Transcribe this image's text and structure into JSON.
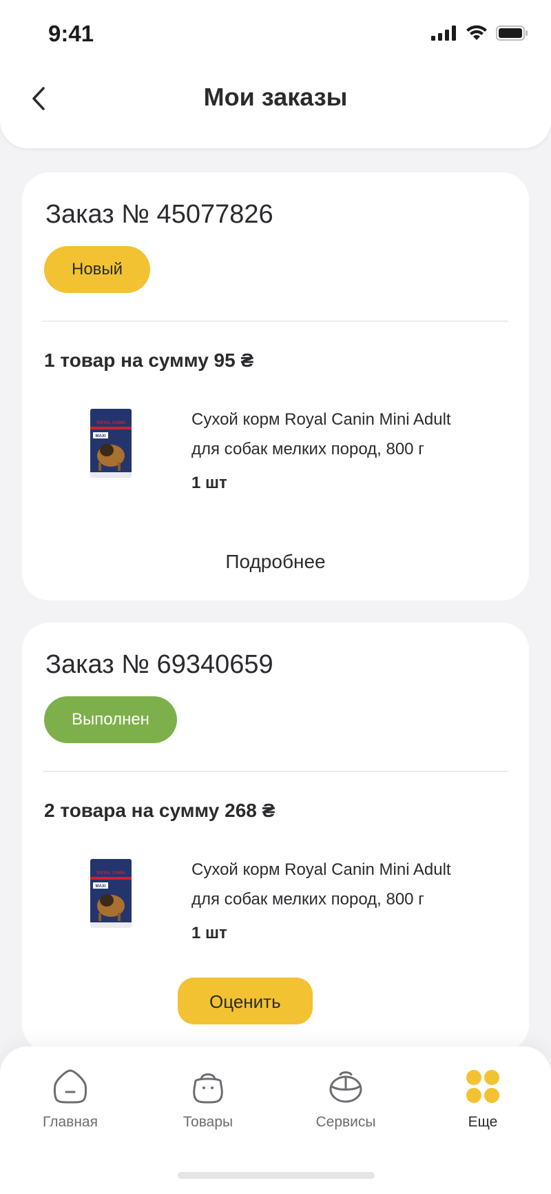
{
  "status_bar": {
    "time": "9:41"
  },
  "header": {
    "title": "Мои заказы"
  },
  "orders": [
    {
      "title": "Заказ № 45077826",
      "status": "Новый",
      "summary": "1 товар на сумму 95 ₴",
      "products": [
        {
          "name": "Сухой корм Royal Canin Mini Adult для собак мелких пород, 800 г",
          "quantity": "1 шт",
          "image_brand": "ROYAL CANIN",
          "image_variant": "MAXI"
        }
      ],
      "details_label": "Подробнее"
    },
    {
      "title": "Заказ № 69340659",
      "status": "Выполнен",
      "summary": "2 товара на сумму 268 ₴",
      "products": [
        {
          "name": "Сухой корм Royal Canin Mini Adult для собак мелких пород, 800 г",
          "quantity": "1 шт",
          "image_brand": "ROYAL CANIN",
          "image_variant": "MAXI"
        }
      ],
      "rate_label": "Оценить"
    }
  ],
  "tabbar": {
    "items": [
      {
        "label": "Главная",
        "icon": "home-icon"
      },
      {
        "label": "Товары",
        "icon": "bag-icon"
      },
      {
        "label": "Сервисы",
        "icon": "pet-carrier-icon"
      },
      {
        "label": "Еще",
        "icon": "more-dots-icon",
        "active": true
      }
    ]
  },
  "colors": {
    "accent_yellow": "#f2c232",
    "status_done_green": "#7db04a",
    "background": "#f3f3f5"
  }
}
